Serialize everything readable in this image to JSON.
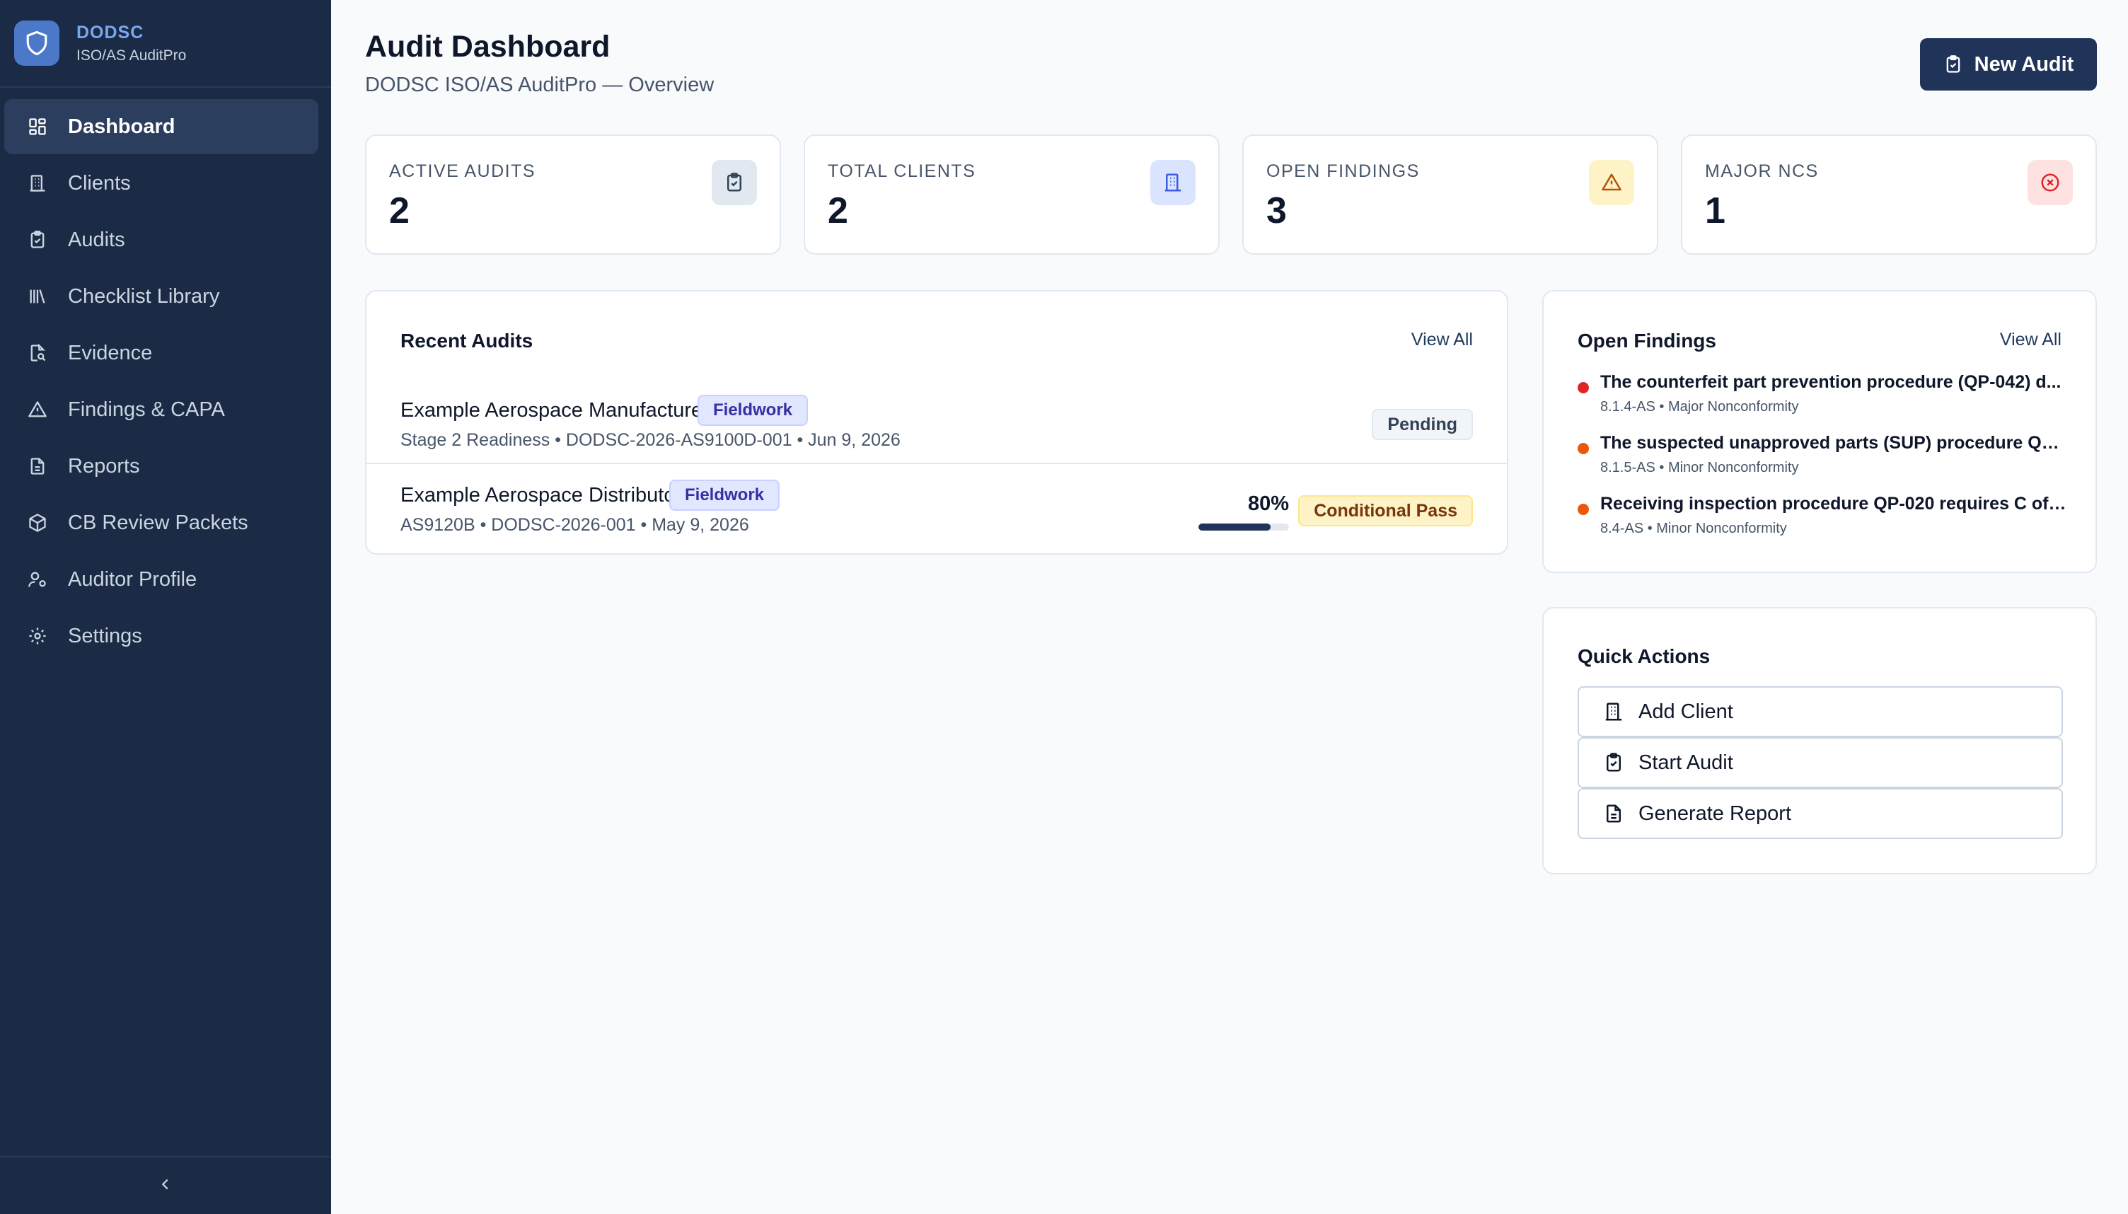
{
  "brand": {
    "name": "DODSC",
    "subtitle": "ISO/AS AuditPro"
  },
  "sidebar": {
    "items": [
      {
        "label": "Dashboard",
        "icon": "dashboard-icon",
        "active": true
      },
      {
        "label": "Clients",
        "icon": "building-icon"
      },
      {
        "label": "Audits",
        "icon": "clipboard-icon"
      },
      {
        "label": "Checklist Library",
        "icon": "library-icon"
      },
      {
        "label": "Evidence",
        "icon": "file-search-icon"
      },
      {
        "label": "Findings & CAPA",
        "icon": "warning-icon"
      },
      {
        "label": "Reports",
        "icon": "document-icon"
      },
      {
        "label": "CB Review Packets",
        "icon": "package-icon"
      },
      {
        "label": "Auditor Profile",
        "icon": "user-cog-icon"
      },
      {
        "label": "Settings",
        "icon": "gear-icon"
      }
    ],
    "collapse_icon": "chevron-left-icon"
  },
  "header": {
    "title": "Audit Dashboard",
    "subtitle": "DODSC ISO/AS AuditPro — Overview",
    "new_audit_label": "New Audit"
  },
  "stats": [
    {
      "label": "ACTIVE AUDITS",
      "value": "2",
      "icon": "clipboard-icon",
      "color": "#475569"
    },
    {
      "label": "TOTAL CLIENTS",
      "value": "2",
      "icon": "building-icon",
      "color": "#3b5bdb"
    },
    {
      "label": "OPEN FINDINGS",
      "value": "3",
      "icon": "warning-icon",
      "color": "#b45309"
    },
    {
      "label": "MAJOR NCS",
      "value": "1",
      "icon": "x-circle-icon",
      "color": "#dc2626"
    }
  ],
  "recent_audits": {
    "title": "Recent Audits",
    "view_all": "View All",
    "rows": [
      {
        "name": "Example Aerospace Manufacturer",
        "phase": "Fieldwork",
        "meta": "Stage 2 Readiness • DODSC-2026-AS9100D-001 • Jun 9, 2026",
        "status": "Pending"
      },
      {
        "name": "Example Aerospace Distributor",
        "phase": "Fieldwork",
        "meta": "AS9120B • DODSC-2026-001 • May 9, 2026",
        "progress_label": "80%",
        "progress": 0.8,
        "status": "Conditional Pass"
      }
    ]
  },
  "open_findings": {
    "title": "Open Findings",
    "view_all": "View All",
    "items": [
      {
        "text": "The counterfeit part prevention procedure (QP-042) d...",
        "meta": "8.1.4-AS • Major Nonconformity",
        "color": "#dc2626"
      },
      {
        "text": "The suspected unapproved parts (SUP) procedure QP-...",
        "meta": "8.1.5-AS • Minor Nonconformity",
        "color": "#ea580c"
      },
      {
        "text": "Receiving inspection procedure QP-020 requires C of ...",
        "meta": "8.4-AS • Minor Nonconformity",
        "color": "#ea580c"
      }
    ]
  },
  "quick_actions": {
    "title": "Quick Actions",
    "items": [
      {
        "label": "Add Client",
        "icon": "building-icon"
      },
      {
        "label": "Start Audit",
        "icon": "clipboard-icon"
      },
      {
        "label": "Generate Report",
        "icon": "document-icon"
      }
    ]
  },
  "colors": {
    "sidebar_bg": "#1b2a45",
    "accent": "#1f3458",
    "brand": "#4b78c8"
  }
}
